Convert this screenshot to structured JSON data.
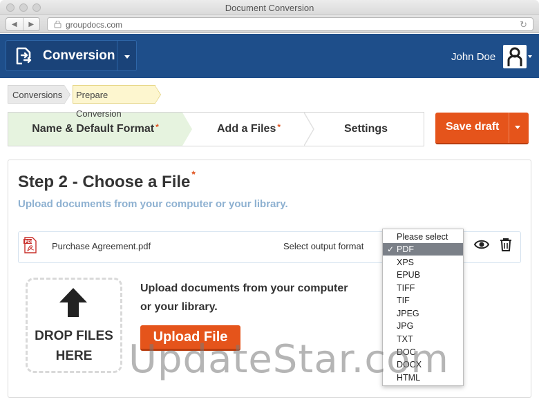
{
  "window": {
    "title": "Document Conversion"
  },
  "browser": {
    "url": "groupdocs.com",
    "back_glyph": "◀",
    "forward_glyph": "▶",
    "reload_glyph": "↻"
  },
  "header": {
    "app_name": "Conversion",
    "user_name": "John Doe",
    "background_color": "#1e4e8a"
  },
  "breadcrumb": [
    "Conversions",
    "Prepare Conversion"
  ],
  "wizard": {
    "steps": [
      {
        "label": "Name & Default Format",
        "required": "*"
      },
      {
        "label": "Add a Files",
        "required": "*"
      },
      {
        "label": "Settings",
        "required": ""
      }
    ]
  },
  "save_draft": {
    "label": "Save draft",
    "color": "#e5541b"
  },
  "main": {
    "title": "Step 2 - Choose a File",
    "title_required": "*",
    "subtitle": "Upload documents from your computer or your library."
  },
  "file": {
    "name": "Purchase Agreement.pdf",
    "format_label": "Select output format"
  },
  "format_dropdown": {
    "options": [
      "Please select",
      "PDF",
      "XPS",
      "EPUB",
      "TIFF",
      "TIF",
      "JPEG",
      "JPG",
      "TXT",
      "DOC",
      "DOCX",
      "HTML"
    ],
    "selected": "PDF",
    "check_glyph": "✓"
  },
  "upload": {
    "drop_line1": "DROP FILES",
    "drop_line2": "HERE",
    "description_line1": "Upload documents from your computer",
    "description_line2": "or your library.",
    "button_label": "Upload File"
  },
  "watermark": "UpdateStar.com"
}
